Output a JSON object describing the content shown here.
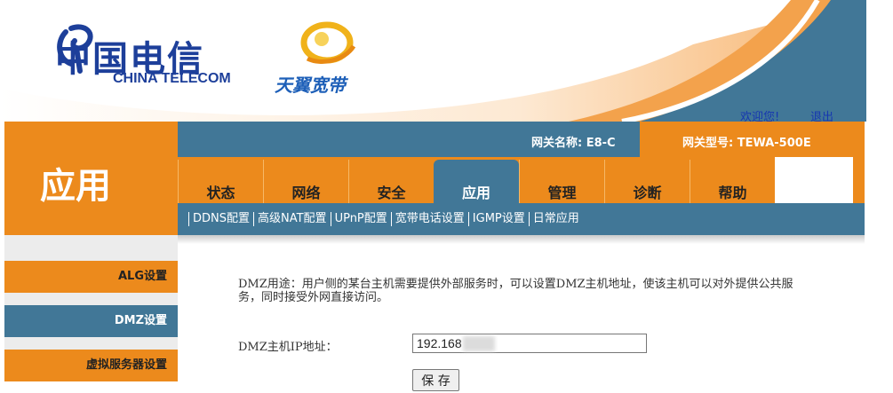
{
  "header": {
    "brand_cn": "中国电信",
    "brand_en": "CHINA TELECOM",
    "sub_brand": "天翼宽带",
    "welcome": "欢迎您!",
    "logout": "退出"
  },
  "page_title": "应用",
  "gateway": {
    "name": "网关名称:  E8-C",
    "model": "网关型号:  TEWA-500E"
  },
  "tabs": [
    "状态",
    "网络",
    "安全",
    "应用",
    "管理",
    "诊断",
    "帮助"
  ],
  "active_tab": "应用",
  "sub_tabs": [
    "DDNS配置",
    "高级NAT配置",
    "UPnP配置",
    "宽带电话设置",
    "IGMP设置",
    "日常应用"
  ],
  "left_nav": [
    "ALG设置",
    "DMZ设置",
    "虚拟服务器设置"
  ],
  "content": {
    "description": "DMZ用途：用户侧的某台主机需要提供外部服务时，可以设置DMZ主机地址，使该主机可以对外提供公共服务，同时接受外网直接访问。",
    "ip_label": "DMZ主机IP地址：",
    "ip_value": "192.168",
    "save_label": "保 存"
  },
  "colors": {
    "orange": "#ec8a1c",
    "blue": "#417797",
    "brand_blue": "#1d3f9a"
  }
}
